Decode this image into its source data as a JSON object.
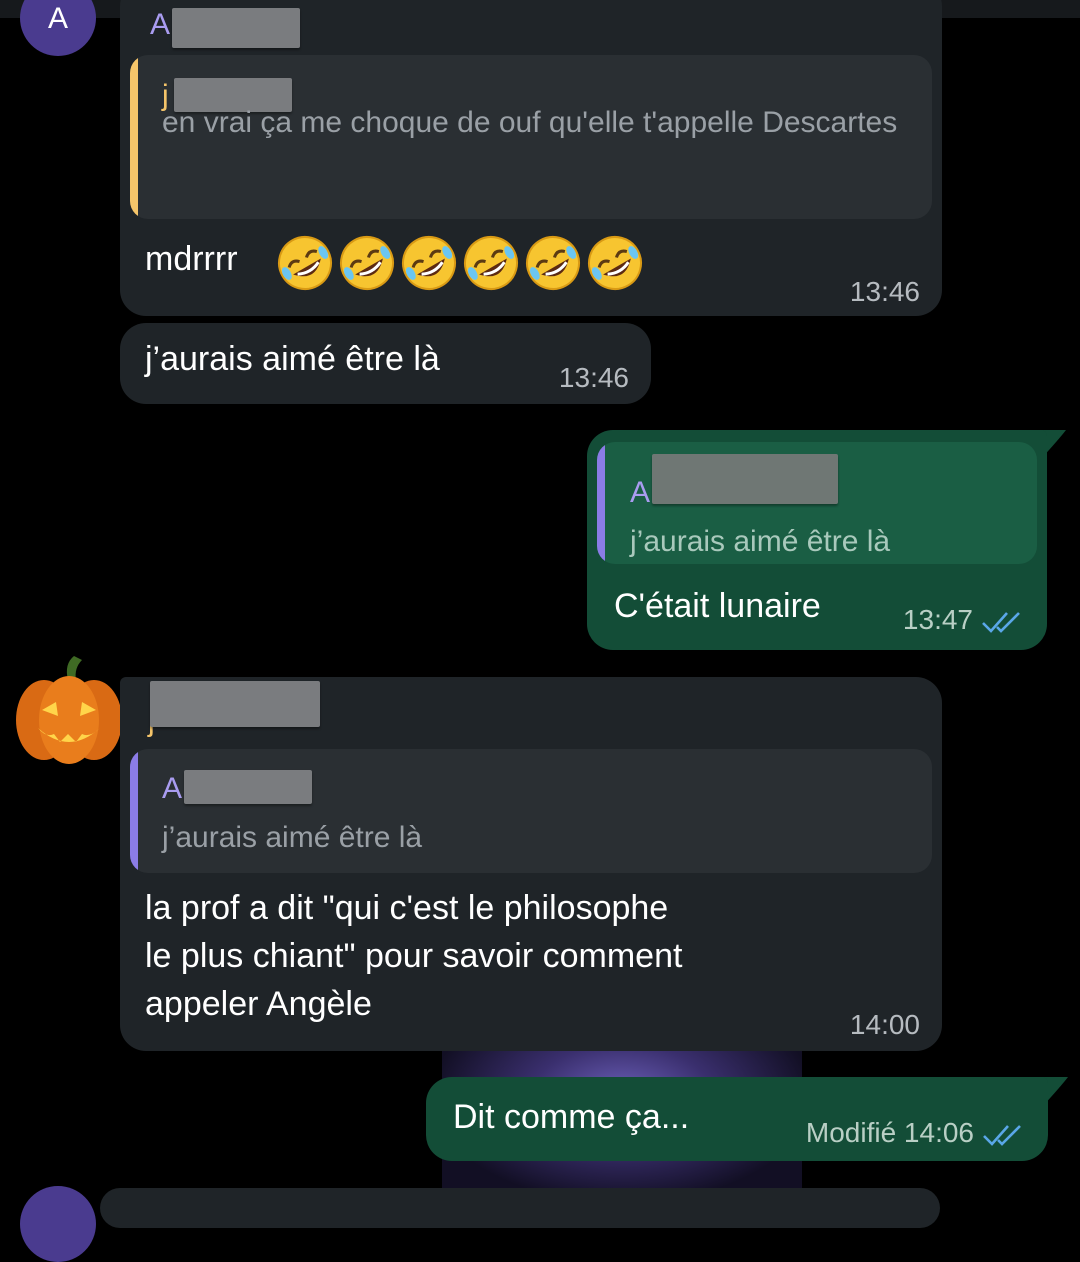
{
  "colors": {
    "background": "#000000",
    "incoming_bubble": "#1f2428",
    "outgoing_bubble": "#134d37",
    "quote_bar_yellow": "#f5c56a",
    "quote_bar_purple": "#8b7ce6",
    "sender_name_purple": "#a99cf0",
    "sender_name_yellow": "#f5c56a",
    "read_ticks": "#5aa7e8"
  },
  "messages": [
    {
      "direction": "incoming",
      "avatar_letter": "A",
      "sender_initial": "A",
      "quote": {
        "sender_initial": "j",
        "text": "en vrai ça me choque de ouf qu'elle t'appelle Descartes"
      },
      "text": "mdrrrr",
      "emoji": [
        "rolling-on-floor-laughing",
        "rolling-on-floor-laughing",
        "rolling-on-floor-laughing",
        "rolling-on-floor-laughing",
        "rolling-on-floor-laughing",
        "rolling-on-floor-laughing"
      ],
      "time": "13:46"
    },
    {
      "direction": "incoming",
      "text": "j’aurais aimé être là",
      "time": "13:46"
    },
    {
      "direction": "outgoing",
      "quote": {
        "sender_initial": "A",
        "text": "j’aurais aimé être là"
      },
      "text": "C'était lunaire",
      "time": "13:47",
      "status_icon": "double-check-read-icon"
    },
    {
      "direction": "incoming",
      "avatar": "pumpkin-avatar",
      "sender_initial": "j",
      "quote": {
        "sender_initial": "A",
        "text": "j’aurais aimé être là"
      },
      "text_lines": [
        "la prof a dit \"qui c'est le philosophe",
        "le plus chiant\" pour savoir comment",
        "appeler Angèle"
      ],
      "time": "14:00"
    },
    {
      "direction": "outgoing",
      "text": "Dit comme ça...",
      "edited_label": "Modifié",
      "time": "14:06",
      "status_icon": "double-check-read-icon"
    }
  ]
}
